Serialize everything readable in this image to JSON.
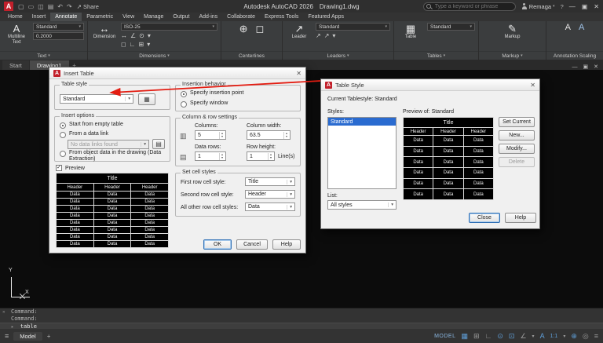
{
  "colors": {
    "arrow_red": "#e31d12",
    "selection_blue": "#2a6bd0",
    "status_icon_blue": "#5f9fd9",
    "logo_red": "#c2202b"
  },
  "titlebar": {
    "logo": "A",
    "qat_icons": {
      "new": "▢",
      "open": "▭",
      "save": "◫",
      "print": "▤",
      "undo": "↶",
      "redo": "↷"
    },
    "share_icon": "↗",
    "share_label": "Share",
    "app_title": "Autodesk AutoCAD 2026",
    "doc_title": "Drawing1.dwg",
    "search_placeholder": "Type a keyword or phrase",
    "user_name": "Remaga",
    "dropdown_glyph": "▾",
    "help_icon": "?",
    "window": {
      "minimize": "—",
      "maximize": "▣",
      "close": "✕"
    }
  },
  "ribbon": {
    "tabs": [
      "Home",
      "Insert",
      "Annotate",
      "Parametric",
      "View",
      "Manage",
      "Output",
      "Add-ins",
      "Collaborate",
      "Express Tools",
      "Featured Apps"
    ],
    "active_tab": "Annotate",
    "panels": {
      "text": {
        "label": "Text",
        "button": "Multiline Text",
        "icon": "A",
        "style": "Standard",
        "height": "0.2000"
      },
      "dimensions": {
        "label": "Dimensions",
        "button": "Dimension",
        "icon": "↔",
        "style": "ISO-25",
        "tools": [
          "↔",
          "∠",
          "⊙",
          "▾",
          "◻",
          "∟",
          "⊞",
          "▾"
        ]
      },
      "centerlines": {
        "label": "Centerlines",
        "tool1": "⊕",
        "tool2": "◻"
      },
      "leaders": {
        "label": "Leaders",
        "button": "Leader",
        "icon": "↗",
        "style": "Standard",
        "tools": [
          "↗",
          "↗",
          "▾"
        ]
      },
      "tables": {
        "label": "Tables",
        "button": "Table",
        "icon": "▦",
        "style": "Standard"
      },
      "markup": {
        "label": "Markup",
        "button": "Markup",
        "icon": "✎"
      },
      "annotation_scaling": {
        "label": "Annotation Scaling",
        "icon1": "A",
        "icon2": "A"
      }
    }
  },
  "filetabs": {
    "start": "Start",
    "drawing": "Drawing1",
    "new_tab": "+",
    "window": {
      "minimize": "—",
      "restore": "▣",
      "close": "✕"
    }
  },
  "canvas": {
    "ucs_x": "X",
    "ucs_y": "Y"
  },
  "insert_table_dialog": {
    "title": "Insert Table",
    "table_style": {
      "label": "Table style",
      "value": "Standard"
    },
    "insert_options": {
      "label": "Insert options",
      "option1": "Start from empty table",
      "option2": "From a data link",
      "data_link_value": "No data links found",
      "option3": "From object data in the drawing (Data Extraction)",
      "preview_label": "Preview"
    },
    "insertion_behavior": {
      "label": "Insertion behavior",
      "option1": "Specify insertion point",
      "option2": "Specify window"
    },
    "column_row": {
      "label": "Column & row settings",
      "columns_label": "Columns:",
      "columns": "5",
      "column_width_label": "Column width:",
      "column_width": "63.5",
      "data_rows_label": "Data rows:",
      "data_rows": "1",
      "row_height_label": "Row height:",
      "row_height": "1",
      "row_height_unit": "Line(s)"
    },
    "cell_styles": {
      "label": "Set cell styles",
      "first_label": "First row cell style:",
      "first": "Title",
      "second_label": "Second row cell style:",
      "second": "Header",
      "other_label": "All other row cell styles:",
      "other": "Data"
    },
    "ok": "OK",
    "cancel": "Cancel",
    "help": "Help",
    "preview_table": {
      "title": "Title",
      "headers": [
        "Header",
        "Header",
        "Header"
      ],
      "cell": "Data",
      "data_rows": 8
    }
  },
  "table_style_dialog": {
    "title": "Table Style",
    "current": "Current Tablestyle: Standard",
    "styles_label": "Styles:",
    "style_item": "Standard",
    "preview_label": "Preview of: Standard",
    "list_label": "List:",
    "list_value": "All styles",
    "set_current": "Set Current",
    "new": "New...",
    "modify": "Modify...",
    "delete": "Delete",
    "close": "Close",
    "help": "Help",
    "preview_table": {
      "title": "Title",
      "headers": [
        "Header",
        "Header",
        "Header"
      ],
      "cell": "Data",
      "data_rows": 6
    }
  },
  "command_line": {
    "close": "✕",
    "history": [
      "Command:",
      "Command:"
    ],
    "prompt_icon": "▸",
    "input": "_table"
  },
  "statusbar": {
    "menu_icon": "≡",
    "model_tab": "Model",
    "new_layout": "+",
    "space_label": "MODEL",
    "scale": "1:1",
    "icons": {
      "grid": "▦",
      "snap": "⊞",
      "ortho": "∟",
      "polar": "⊙",
      "osnap": "⊡",
      "dyn": "∠",
      "dropdown": "▾",
      "annotate": "A",
      "settings": "⊕",
      "isolate": "◎",
      "menu": "≡"
    }
  },
  "ui": {
    "close_glyph": "✕",
    "check_glyph": "✓",
    "table_icon": "▦",
    "link_icon": "▤"
  }
}
